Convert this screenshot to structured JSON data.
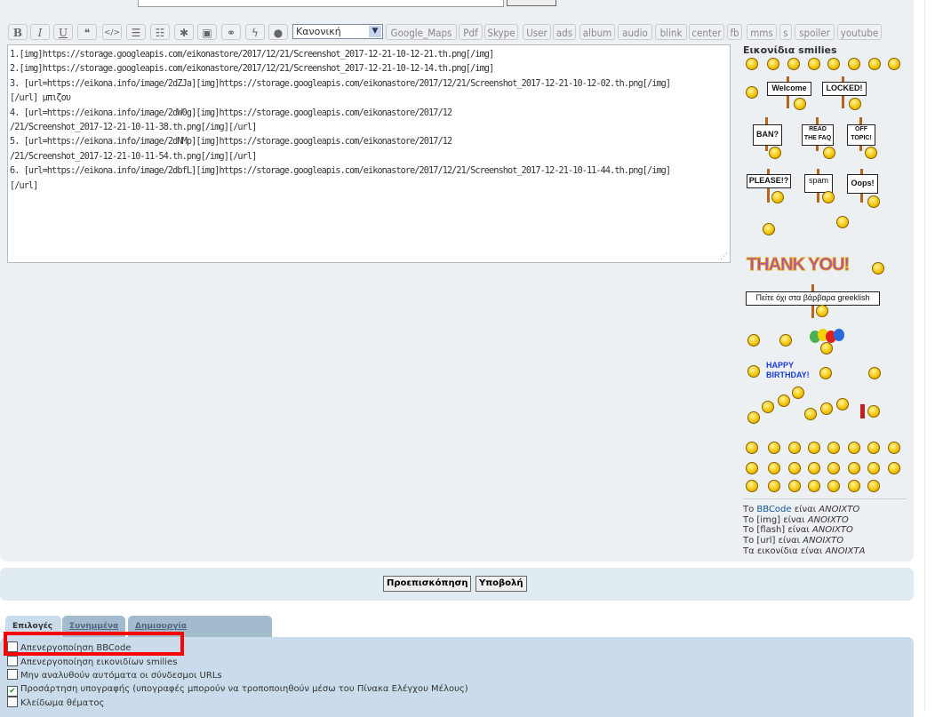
{
  "toolbar": {
    "icon_buttons": [
      {
        "name": "bold",
        "glyph": "B"
      },
      {
        "name": "italic",
        "glyph": "I"
      },
      {
        "name": "underline",
        "glyph": "U"
      },
      {
        "name": "quote",
        "glyph": "❝"
      },
      {
        "name": "code",
        "glyph": "</>"
      },
      {
        "name": "list",
        "glyph": "☰"
      },
      {
        "name": "ordered-list",
        "glyph": "☷"
      },
      {
        "name": "list-item",
        "glyph": "✱"
      },
      {
        "name": "image",
        "glyph": "▣"
      },
      {
        "name": "link",
        "glyph": "⚭"
      },
      {
        "name": "flash",
        "glyph": "ϟ"
      },
      {
        "name": "color",
        "glyph": "●"
      }
    ],
    "font_size_select": "Κανονική",
    "custom_buttons": [
      "Google_Maps",
      "Pdf",
      "Skype",
      "User",
      "ads",
      "album",
      "audio",
      "blink",
      "center",
      "fb",
      "mms",
      "s",
      "spoiler",
      "youtube"
    ]
  },
  "editor": {
    "value": "1.[img]https://storage.googleapis.com/eikonastore/2017/12/21/Screenshot_2017-12-21-10-12-21.th.png[/img]\n2.[img]https://storage.googleapis.com/eikonastore/2017/12/21/Screenshot_2017-12-21-10-12-14.th.png[/img]\n3. [url=https://eikona.info/image/2dZJa][img]https://storage.googleapis.com/eikonastore/2017/12/21/Screenshot_2017-12-21-10-12-02.th.png[/img]\n[/url] μπιζου\n4. [url=https://eikona.info/image/2dW0g][img]https://storage.googleapis.com/eikonastore/2017/12\n/21/Screenshot_2017-12-21-10-11-38.th.png[/img][/url]\n5. [url=https://eikona.info/image/2dNMp][img]https://storage.googleapis.com/eikonastore/2017/12\n/21/Screenshot_2017-12-21-10-11-54.th.png[/img][/url]\n6. [url=https://eikona.info/image/2dbfL][img]https://storage.googleapis.com/eikonastore/2017/12/21/Screenshot_2017-12-21-10-11-44.th.png[/img]\n[/url]"
  },
  "smilies": {
    "title": "Εικονίδια smilies",
    "signs": {
      "welcome": "Welcome",
      "locked": "LOCKED!",
      "ban": "BAN?",
      "faq": "READ THE FAQ",
      "offtopic": "OFF TOPIC!",
      "please": "PLEASE!?",
      "spam": "spam",
      "oops": "Oops!",
      "thankyou": "THANK YOU!",
      "greeklish": "Πείτε όχι στα βάρβαρα greeklish",
      "birthday": "HAPPY BIRTHDAY!"
    }
  },
  "status": {
    "lines": [
      {
        "prefix": "Το ",
        "link": "BBCode",
        "mid": " είναι ",
        "state": "ΑΝΟΙΧΤΟ"
      },
      {
        "prefix": "Το [img]",
        "link": "",
        "mid": " είναι ",
        "state": "ΑΝΟΙΧΤΟ"
      },
      {
        "prefix": "Το [flash]",
        "link": "",
        "mid": " είναι ",
        "state": "ΑΝΟΙΧΤΟ"
      },
      {
        "prefix": "Το [url]",
        "link": "",
        "mid": " είναι ",
        "state": "ΑΝΟΙΧΤΟ"
      },
      {
        "prefix": "Τα εικονίδια",
        "link": "",
        "mid": " είναι ",
        "state": "ΑΝΟΙΧΤΑ"
      }
    ]
  },
  "actions": {
    "preview": "Προεπισκόπηση",
    "submit": "Υποβολή"
  },
  "tabs": [
    {
      "label": "Επιλογές",
      "active": true
    },
    {
      "label": "Συνημμένα",
      "active": false
    },
    {
      "label": "Δημιουργία δημοψηφίσματος",
      "active": false
    }
  ],
  "options": [
    {
      "label": "Απενεργοποίηση BBCode",
      "checked": false
    },
    {
      "label": "Απενεργοποίηση εικονιδίων smilies",
      "checked": false
    },
    {
      "label": "Μην αναλυθούν αυτόματα οι σύνδεσμοι URLs",
      "checked": false
    },
    {
      "label": "Προσάρτηση υπογραφής (υπογραφές μπορούν να τροποποιηθούν μέσω του Πίνακα Ελέγχου Μέλους)",
      "checked": true
    },
    {
      "label": "Κλείδωμα θέματος",
      "checked": false
    }
  ],
  "colors": {
    "panel": "#ecf0f3",
    "options_panel": "#cadceb",
    "highlight": "#ff0000",
    "link": "#105289"
  }
}
